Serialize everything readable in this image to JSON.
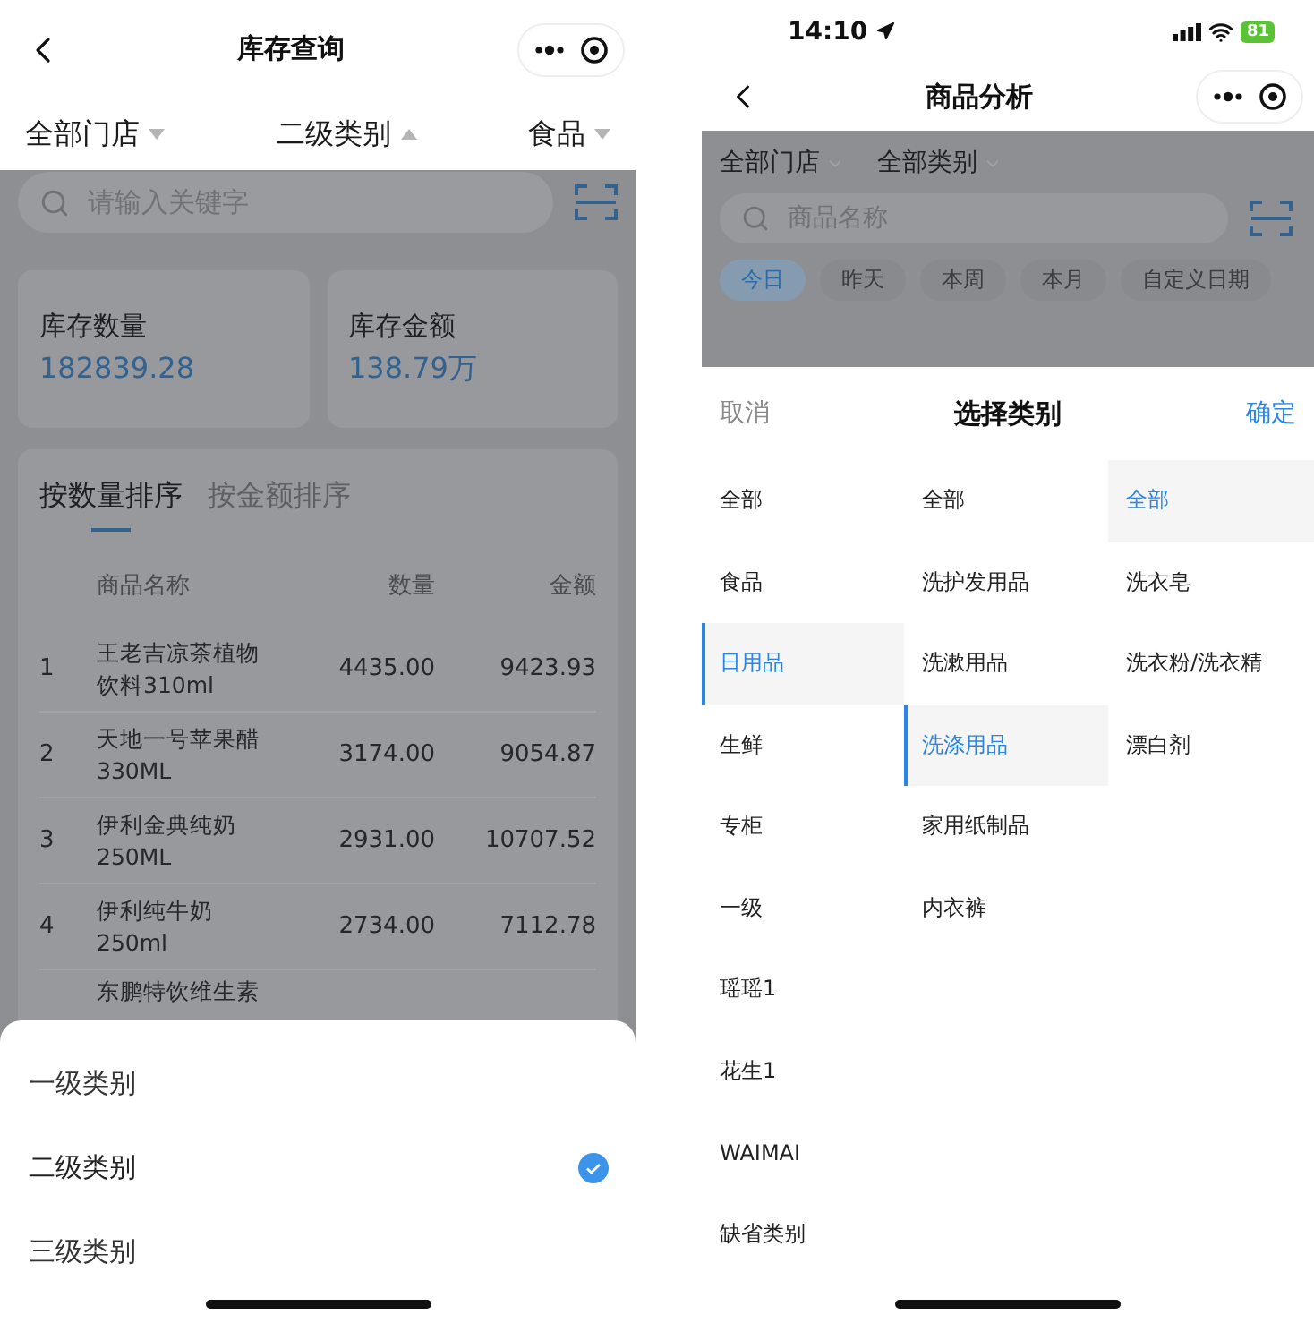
{
  "left": {
    "nav": {
      "title": "库存查询"
    },
    "filters": [
      {
        "label": "全部门店",
        "expanded": false
      },
      {
        "label": "二级类别",
        "expanded": true
      },
      {
        "label": "食品",
        "expanded": false
      }
    ],
    "search": {
      "placeholder": "请输入关键字"
    },
    "stats": [
      {
        "label": "库存数量",
        "value": "182839.28"
      },
      {
        "label": "库存金额",
        "value": "138.79万"
      }
    ],
    "tabs": [
      {
        "label": "按数量排序",
        "selected": true
      },
      {
        "label": "按金额排序",
        "selected": false
      }
    ],
    "table": {
      "columns": [
        "商品名称",
        "数量",
        "金额"
      ],
      "rows": [
        {
          "rank": "1",
          "name": "王老吉凉茶植物饮料310ml",
          "quantity": "4435.00",
          "amount": "9423.93"
        },
        {
          "rank": "2",
          "name": "天地一号苹果醋330ML",
          "quantity": "3174.00",
          "amount": "9054.87"
        },
        {
          "rank": "3",
          "name": "伊利金典纯奶250ML",
          "quantity": "2931.00",
          "amount": "10707.52"
        },
        {
          "rank": "4",
          "name": "伊利纯牛奶250ml",
          "quantity": "2734.00",
          "amount": "7112.78"
        },
        {
          "name": "东鹏特饮维生素"
        }
      ]
    },
    "sheet": {
      "options": [
        {
          "label": "一级类别",
          "checked": false
        },
        {
          "label": "二级类别",
          "checked": true
        },
        {
          "label": "三级类别",
          "checked": false
        }
      ]
    }
  },
  "right": {
    "status_bar": {
      "time": "14:10",
      "battery": "81"
    },
    "nav": {
      "title": "商品分析"
    },
    "filters": [
      {
        "label": "全部门店"
      },
      {
        "label": "全部类别"
      }
    ],
    "search": {
      "placeholder": "商品名称"
    },
    "date_chips": [
      {
        "label": "今日",
        "selected": true
      },
      {
        "label": "昨天",
        "selected": false
      },
      {
        "label": "本周",
        "selected": false
      },
      {
        "label": "本月",
        "selected": false
      },
      {
        "label": "自定义日期",
        "selected": false
      }
    ],
    "picker": {
      "cancel": "取消",
      "title": "选择类别",
      "confirm": "确定",
      "columns": [
        [
          {
            "label": "全部",
            "selected": false
          },
          {
            "label": "食品",
            "selected": false
          },
          {
            "label": "日用品",
            "selected": true
          },
          {
            "label": "生鲜",
            "selected": false
          },
          {
            "label": "专柜",
            "selected": false
          },
          {
            "label": "一级",
            "selected": false
          },
          {
            "label": "瑶瑶1",
            "selected": false
          },
          {
            "label": "花生1",
            "selected": false
          },
          {
            "label": "WAIMAI",
            "selected": false
          },
          {
            "label": "缺省类别",
            "selected": false
          }
        ],
        [
          {
            "label": "全部",
            "selected": false
          },
          {
            "label": "洗护发用品",
            "selected": false
          },
          {
            "label": "洗漱用品",
            "selected": false
          },
          {
            "label": "洗涤用品",
            "selected": true
          },
          {
            "label": "家用纸制品",
            "selected": false
          },
          {
            "label": "内衣裤",
            "selected": false
          }
        ],
        [
          {
            "label": "全部",
            "selected": true
          },
          {
            "label": "洗衣皂",
            "selected": false
          },
          {
            "label": "洗衣粉/洗衣精",
            "selected": false
          },
          {
            "label": "漂白剂",
            "selected": false
          }
        ]
      ]
    }
  }
}
